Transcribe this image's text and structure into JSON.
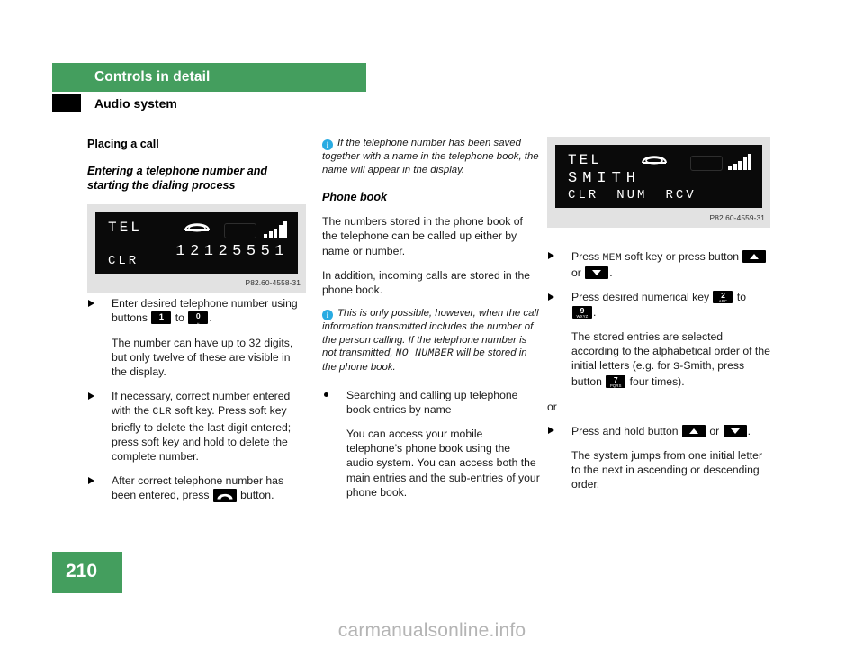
{
  "header": {
    "chapter_title": "Controls in detail",
    "section_title": "Audio system"
  },
  "footer": {
    "page_number": "210",
    "watermark": "carmanualsonline.info"
  },
  "left_column": {
    "heading": "Placing a call",
    "subheading": "Entering a telephone number and starting the dialing process",
    "figure": {
      "caption": "P82.60-4558-31",
      "lcd": {
        "label": "TEL",
        "number": "12125551",
        "softkey": "CLR",
        "handset_icon": "phone-handset-icon",
        "signal_icon": "signal-bars-icon"
      }
    },
    "items": [
      {
        "type": "arrow",
        "parts": [
          {
            "t": "text",
            "v": "Enter desired telephone number using buttons "
          },
          {
            "t": "key",
            "digit": "1",
            "letters": ""
          },
          {
            "t": "text",
            "v": " to "
          },
          {
            "t": "key",
            "digit": "0",
            "letters": "␣"
          },
          {
            "t": "text",
            "v": "."
          }
        ]
      },
      {
        "type": "indent",
        "parts": [
          {
            "t": "text",
            "v": "The number can have up to 32 digits, but only twelve of these are visible in the display."
          }
        ]
      },
      {
        "type": "arrow",
        "parts": [
          {
            "t": "text",
            "v": "If necessary, correct number entered with the "
          },
          {
            "t": "mono",
            "v": "CLR"
          },
          {
            "t": "text",
            "v": " soft key. Press soft key briefly to delete the last digit entered; press soft key and hold to delete the complete number."
          }
        ]
      },
      {
        "type": "arrow",
        "parts": [
          {
            "t": "text",
            "v": "After correct telephone number has been entered, press "
          },
          {
            "t": "phonekey",
            "icon": "phone-receiver-icon"
          },
          {
            "t": "text",
            "v": " button."
          }
        ]
      }
    ]
  },
  "middle_column": {
    "note1": "If the telephone number has been saved together with a name in the telephone book, the name will appear in the display.",
    "heading": "Phone book",
    "para1": "The numbers stored in the phone book of the telephone can be called up either by name or number.",
    "para2": "In addition, incoming calls are stored in the phone book.",
    "note2_pre": "This is only possible, however, when the call information transmitted includes the number of the person calling. If the telephone number is not transmitted, ",
    "note2_mono": "NO NUMBER",
    "note2_post": " will be stored in the phone book.",
    "bullet1": "Searching and calling up telephone book entries by name",
    "bullet1_body": "You can access your mobile telephone’s phone book using the audio system. You can access both the main entries and the sub-entries of your phone book."
  },
  "right_column": {
    "figure": {
      "caption": "P82.60-4559-31",
      "lcd": {
        "label": "TEL",
        "name": "SMITH",
        "softkeys": [
          "CLR",
          "NUM",
          "RCV"
        ],
        "handset_icon": "phone-handset-icon",
        "signal_icon": "signal-bars-icon"
      }
    },
    "items": [
      {
        "type": "arrow",
        "parts": [
          {
            "t": "text",
            "v": "Press "
          },
          {
            "t": "mono",
            "v": "MEM"
          },
          {
            "t": "text",
            "v": " soft key or press button "
          },
          {
            "t": "arrowkey",
            "dir": "up"
          },
          {
            "t": "text",
            "v": " or "
          },
          {
            "t": "arrowkey",
            "dir": "down"
          },
          {
            "t": "text",
            "v": "."
          }
        ]
      },
      {
        "type": "arrow",
        "parts": [
          {
            "t": "text",
            "v": "Press desired numerical key "
          },
          {
            "t": "key",
            "digit": "2",
            "letters": "ABC"
          },
          {
            "t": "text",
            "v": " to "
          },
          {
            "t": "key",
            "digit": "9",
            "letters": "WXYZ"
          },
          {
            "t": "text",
            "v": "."
          }
        ]
      },
      {
        "type": "indent",
        "parts": [
          {
            "t": "text",
            "v": "The stored entries are selected according to the alphabetical order of the initial letters (e.g. for "
          },
          {
            "t": "mono",
            "v": "S"
          },
          {
            "t": "text",
            "v": "-Smith, press button "
          },
          {
            "t": "key",
            "digit": "7",
            "letters": "PQRS"
          },
          {
            "t": "text",
            "v": " four times)."
          }
        ]
      },
      {
        "type": "or",
        "parts": [
          {
            "t": "text",
            "v": "or"
          }
        ]
      },
      {
        "type": "arrow",
        "parts": [
          {
            "t": "text",
            "v": "Press and hold button "
          },
          {
            "t": "arrowkey",
            "dir": "up"
          },
          {
            "t": "text",
            "v": " or "
          },
          {
            "t": "arrowkey",
            "dir": "down"
          },
          {
            "t": "text",
            "v": "."
          }
        ]
      },
      {
        "type": "indent",
        "parts": [
          {
            "t": "text",
            "v": "The system jumps from one initial letter to the next in ascending or descending order."
          }
        ]
      }
    ]
  },
  "colors": {
    "brand_green": "#449e5e",
    "info_blue": "#29abe2",
    "lcd_background": "#0a0a0a",
    "figure_background": "#e2e2e2"
  }
}
